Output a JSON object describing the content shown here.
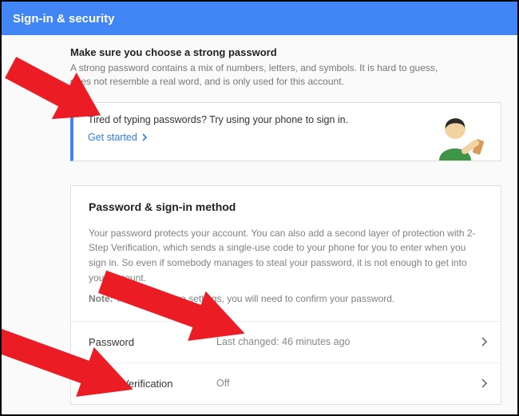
{
  "header": {
    "title": "Sign-in & security"
  },
  "strong_password": {
    "title": "Make sure you choose a strong password",
    "desc": "A strong password contains a mix of numbers, letters, and symbols. It is hard to guess, does not resemble a real word, and is only used for this account."
  },
  "phone_signin": {
    "text": "Tired of typing passwords? Try using your phone to sign in.",
    "link": "Get started"
  },
  "signin_method": {
    "heading": "Password & sign-in method",
    "desc": "Your password protects your account. You can also add a second layer of protection with 2-Step Verification, which sends a single-use code to your phone for you to enter when you sign in. So even if somebody manages to steal your password, it is not enough to get into your account.",
    "note_label": "Note:",
    "note_text": " To change these settings, you will need to confirm your password.",
    "rows": [
      {
        "label": "Password",
        "value": "Last changed: 46 minutes ago"
      },
      {
        "label": "2-Step Verification",
        "value": "Off"
      }
    ]
  }
}
